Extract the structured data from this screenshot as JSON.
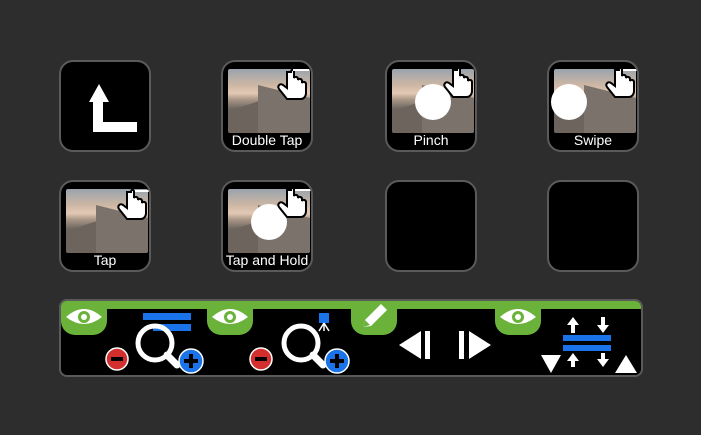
{
  "keys": [
    {
      "id": "back",
      "label": ""
    },
    {
      "id": "double-tap",
      "label": "Double Tap"
    },
    {
      "id": "pinch",
      "label": "Pinch"
    },
    {
      "id": "swipe",
      "label": "Swipe"
    },
    {
      "id": "tap",
      "label": "Tap"
    },
    {
      "id": "tap-and-hold",
      "label": "Tap and Hold"
    },
    {
      "id": "empty-1",
      "label": ""
    },
    {
      "id": "empty-2",
      "label": ""
    }
  ],
  "colors": {
    "background": "#2d2d2d",
    "key_border": "#5a5a5a",
    "accent_green": "#6ab23a",
    "accent_blue": "#1a73e8",
    "zoom_minus_red": "#d32f2f"
  },
  "toolbar": {
    "sections": [
      {
        "id": "zoom-fit",
        "icons": [
          "eye-icon",
          "zoom-out-icon",
          "magnifier-icon",
          "zoom-in-icon",
          "blue-bars-icon"
        ]
      },
      {
        "id": "zoom-point",
        "icons": [
          "eye-icon",
          "zoom-out-icon",
          "magnifier-icon",
          "zoom-in-icon",
          "easel-icon"
        ]
      },
      {
        "id": "frame-step",
        "icons": [
          "pencil-icon",
          "step-back-icon",
          "step-forward-icon"
        ]
      },
      {
        "id": "spacing",
        "icons": [
          "eye-icon",
          "spacing-icon",
          "triangle-down-icon",
          "triangle-up-icon"
        ]
      }
    ]
  }
}
